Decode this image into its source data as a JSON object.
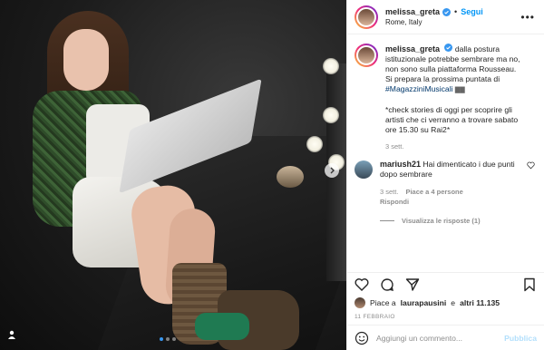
{
  "header": {
    "username": "melissa_greta",
    "follow_label": "Segui",
    "location": "Rome, Italy",
    "dot": "•",
    "more": "•••"
  },
  "caption": {
    "username": "melissa_greta",
    "text": "dalla postura istituzionale potrebbe sembrare ma no, non sono sulla piattaforma Rousseau.",
    "text2": "Si prepara la prossima puntata di",
    "hashtag": "#MagazziniMusicali",
    "flag": "▇▇",
    "text3": "*check stories di oggi per scoprire gli artisti che ci verranno a trovare sabato ore 15.30 su Rai2*",
    "time": "3 sett."
  },
  "comment": {
    "username": "mariush21",
    "text": "Hai dimenticato i due punti dopo sembrare",
    "time": "3 sett.",
    "likes": "Piace a 4 persone",
    "reply": "Rispondi",
    "view_replies": "Visualizza le risposte (1)"
  },
  "likes": {
    "prefix": "Piace a",
    "user": "laurapausini",
    "middle": "e",
    "others": "altri 11.135"
  },
  "date": "11 FEBBRAIO",
  "add_comment": {
    "placeholder": "Aggiungi un commento...",
    "publish": "Pubblica"
  },
  "colors": {
    "accent": "#0095f6",
    "hashtag": "#00376b",
    "muted": "#8e8e8e",
    "publish_disabled": "#b2dffc"
  },
  "carousel": {
    "slides": 3,
    "active": 0
  }
}
